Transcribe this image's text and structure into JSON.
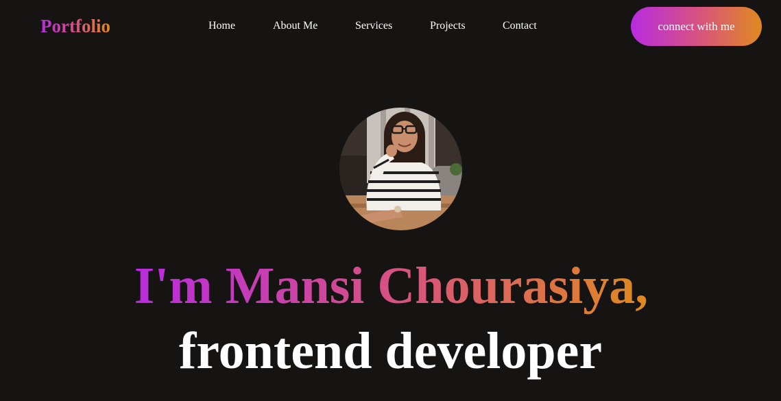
{
  "navbar": {
    "logo": "Portfolio",
    "links": [
      {
        "label": "Home"
      },
      {
        "label": "About Me"
      },
      {
        "label": "Services"
      },
      {
        "label": "Projects"
      },
      {
        "label": "Contact"
      }
    ],
    "cta_label": "connect with me"
  },
  "hero": {
    "avatar_icon": "profile-photo",
    "intro": "I'm Mansi Chourasiya,",
    "role": "frontend developer"
  },
  "colors": {
    "background": "#161313",
    "gradient_start": "#b82be0",
    "gradient_mid": "#d9557a",
    "gradient_end": "#df8a1e",
    "text": "#ffffff"
  }
}
